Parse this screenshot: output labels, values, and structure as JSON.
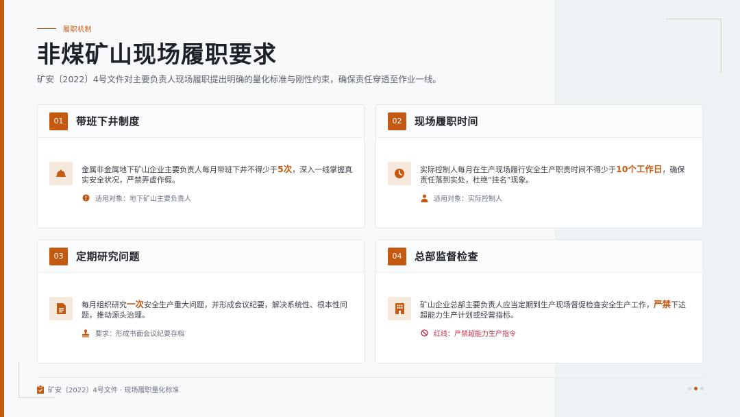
{
  "header": {
    "kicker": "履职机制",
    "title": "非煤矿山现场履职要求",
    "subtitle": "矿安〔2022〕4号文件对主要负责人现场履职提出明确的量化标准与刚性约束，确保责任穿透至作业一线。"
  },
  "cards": [
    {
      "number": "01",
      "title": "带班下井制度",
      "icon": "hard-hat-icon",
      "desc_before": "金属非金属地下矿山企业主要负责人每月带班下井不得少于",
      "desc_highlight": "5次",
      "desc_after": "，深入一线掌握真实安全状况，严禁弄虚作假。",
      "meta_icon": "alert-circle-icon",
      "meta_text": "适用对象：地下矿山主要负责人"
    },
    {
      "number": "02",
      "title": "现场履职时间",
      "icon": "clock-icon",
      "desc_before": "实际控制人每月在生产现场履行安全生产职责时间不得少于",
      "desc_highlight": "10个工作日",
      "desc_after": "，确保责任落到实处，杜绝“挂名”现象。",
      "meta_icon": "person-icon",
      "meta_text": "适用对象：实际控制人"
    },
    {
      "number": "03",
      "title": "定期研究问题",
      "icon": "document-icon",
      "desc_before": "每月组织研究",
      "desc_highlight": "一次",
      "desc_after": "安全生产重大问题，并形成会议纪要，解决系统性、根本性问题，推动源头治理。",
      "meta_icon": "stamp-icon",
      "meta_text": "要求：形成书面会议纪要存档"
    },
    {
      "number": "04",
      "title": "总部监督检查",
      "icon": "building-icon",
      "desc_before": "矿山企业总部主要负责人应当定期到生产现场督促检查安全生产工作，",
      "desc_highlight": "严禁",
      "desc_after": "下达超能力生产计划或经营指标。",
      "meta_icon": "ban-icon",
      "meta_text": "红线：严禁超能力生产指令"
    }
  ],
  "footer": {
    "text": "矿安〔2022〕4号文件 · 现场履职量化标准",
    "page_indicator": {
      "total": 3,
      "current": 2
    }
  },
  "colors": {
    "accent": "#c45a12",
    "danger": "#c2304a",
    "text": "#1d2129"
  }
}
